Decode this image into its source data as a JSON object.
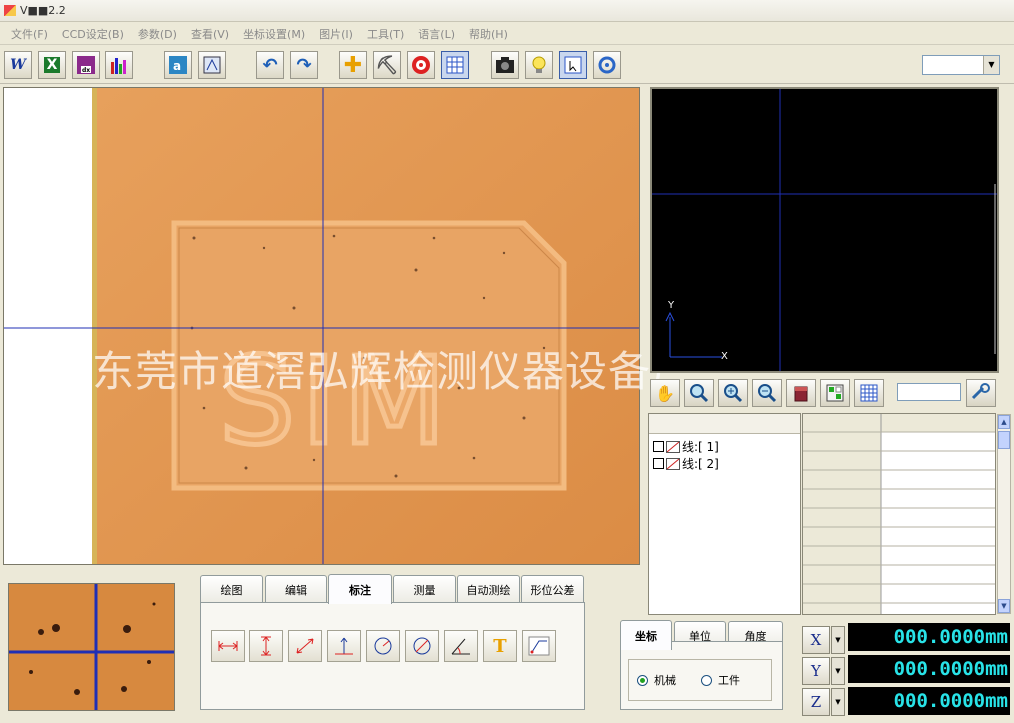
{
  "window": {
    "title": "V■■2.2"
  },
  "menu": [
    "文件(F)",
    "CCD设定(B)",
    "参数(D)",
    "查看(V)",
    "坐标设置(M)",
    "图片(I)",
    "工具(T)",
    "语言(L)",
    "帮助(H)"
  ],
  "toolbar": {
    "buttons": [
      "word-icon",
      "excel-icon",
      "save-dxf-icon",
      "bar-chart-icon",
      "auto-focus-icon",
      "calibrate-icon",
      "undo-icon",
      "redo-icon",
      "crosshair-icon",
      "pickaxe-icon",
      "target-icon",
      "grid-icon",
      "camera-icon",
      "light-bulb-icon",
      "select-icon",
      "refresh-icon"
    ],
    "dropdown_value": ""
  },
  "camera": {
    "watermark": "东莞市道滘弘辉检测仪器设备厂",
    "engraved_text": "SIM"
  },
  "graph": {
    "y_label": "Y",
    "x_label": "X",
    "tools": [
      "hand-icon",
      "zoom-window-icon",
      "zoom-in-icon",
      "zoom-out-icon",
      "eraser-icon",
      "layout-icon",
      "grid-icon"
    ],
    "input_value": ""
  },
  "features": [
    {
      "label": "线:[ 1]"
    },
    {
      "label": "线:[ 2]"
    }
  ],
  "tool_tabs": {
    "tabs": [
      "绘图",
      "编辑",
      "标注",
      "测量",
      "自动测绘",
      "形位公差"
    ],
    "selected": "标注",
    "tools": [
      "horizontal-dimension-icon",
      "vertical-dimension-icon",
      "aligned-dimension-icon",
      "perpendicular-icon",
      "radius-icon",
      "diameter-icon",
      "angle-icon",
      "text-icon",
      "leader-icon"
    ]
  },
  "coord_tabs": {
    "tabs": [
      "坐标",
      "单位",
      "角度"
    ],
    "selected": "坐标",
    "radios": [
      {
        "label": "机械",
        "checked": true
      },
      {
        "label": "工件",
        "checked": false
      }
    ]
  },
  "readouts": [
    {
      "axis": "X",
      "value": "000.0000mm"
    },
    {
      "axis": "Y",
      "value": "000.0000mm"
    },
    {
      "axis": "Z",
      "value": "000.0000mm"
    }
  ],
  "colors": {
    "readout_text": "#28e3e8",
    "crosshair": "#1f2fb5",
    "graph_bg": "#000000",
    "camera_bg": "#e2954d"
  }
}
